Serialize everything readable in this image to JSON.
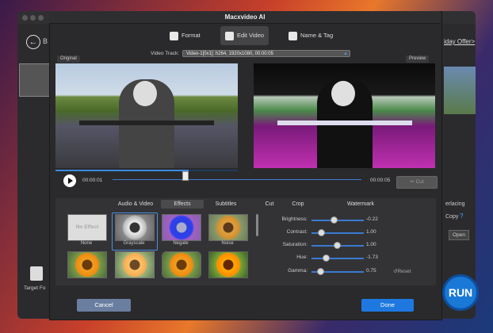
{
  "dialog": {
    "title": "Macxvideo AI"
  },
  "tabs": [
    {
      "label": "Format"
    },
    {
      "label": "Edit Video"
    },
    {
      "label": "Name & Tag"
    }
  ],
  "video_track": {
    "label": "Video Track:",
    "value": "Video-1[0x1]: h264, 1920x1080, 00:00:05"
  },
  "panes": {
    "original": "Original",
    "preview": "Preview"
  },
  "playback": {
    "current_time": "00:00:01",
    "end_time": "00:00:05",
    "cut_label": "Cut",
    "progress": 0.73,
    "position": 0.29
  },
  "bottom_tabs": [
    {
      "label": "Audio & Video"
    },
    {
      "label": "Effects"
    },
    {
      "label": "Subtitles"
    },
    {
      "label": "Cut"
    },
    {
      "label": "Crop"
    },
    {
      "label": "Watermark"
    }
  ],
  "effects": [
    {
      "label": "None",
      "thumb_text": "No Effect"
    },
    {
      "label": "Grayscale"
    },
    {
      "label": "Negate"
    },
    {
      "label": "Noise"
    }
  ],
  "sliders": [
    {
      "label": "Brightness:",
      "value": "-0.22",
      "level": 0.42
    },
    {
      "label": "Contrast:",
      "value": "1.00",
      "level": 0.18
    },
    {
      "label": "Saturation:",
      "value": "1.00",
      "level": 0.48
    },
    {
      "label": "Hue:",
      "value": "-1.73",
      "level": 0.28
    },
    {
      "label": "Gamma:",
      "value": "0.75",
      "level": 0.16
    }
  ],
  "reset_label": "Reset",
  "footer": {
    "cancel": "Cancel",
    "done": "Done"
  },
  "background": {
    "offer": "iday Offer>",
    "b": "B",
    "interlacing": "erlacing",
    "copy": "Copy",
    "q": "?",
    "open": "Open",
    "run": "RUN",
    "target": "Target Fo"
  },
  "colors": {
    "accent": "#1e78e0",
    "cancel": "#6a7fa0"
  }
}
